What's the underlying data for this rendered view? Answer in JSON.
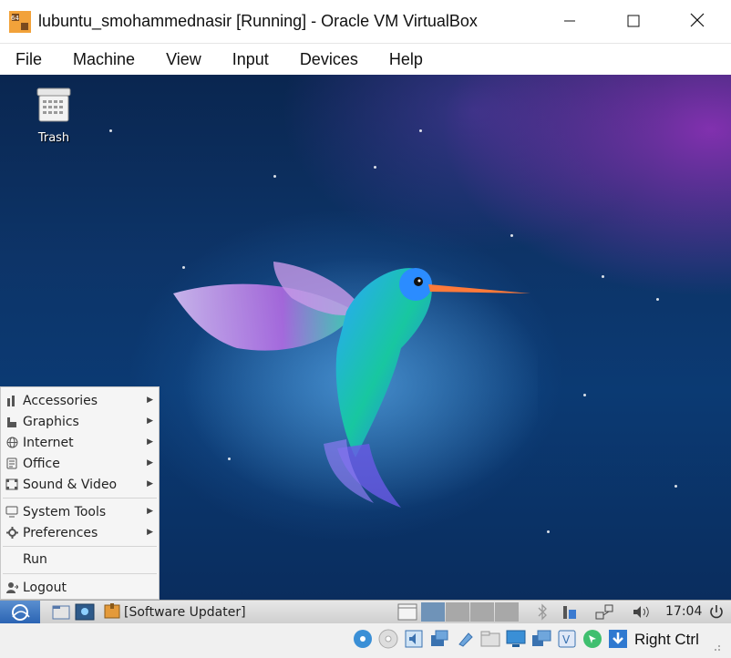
{
  "window": {
    "title": "lubuntu_smohammednasir [Running] - Oracle VM VirtualBox",
    "controls": [
      "minimize-icon",
      "maximize-icon",
      "close-icon"
    ]
  },
  "menubar": {
    "items": [
      "File",
      "Machine",
      "View",
      "Input",
      "Devices",
      "Help"
    ]
  },
  "desktop": {
    "icons": [
      {
        "label": "Trash",
        "icon": "trash-icon"
      }
    ]
  },
  "start_menu": {
    "items": [
      {
        "label": "Accessories",
        "icon": "accessories-icon",
        "submenu": true
      },
      {
        "label": "Graphics",
        "icon": "graphics-icon",
        "submenu": true
      },
      {
        "label": "Internet",
        "icon": "globe-icon",
        "submenu": true
      },
      {
        "label": "Office",
        "icon": "office-icon",
        "submenu": true
      },
      {
        "label": "Sound & Video",
        "icon": "film-icon",
        "submenu": true
      },
      {
        "label": "System Tools",
        "icon": "monitor-icon",
        "submenu": true
      },
      {
        "label": "Preferences",
        "icon": "gear-icon",
        "submenu": true
      },
      {
        "label": "Run"
      },
      {
        "label": "Logout",
        "icon": "logout-icon"
      }
    ]
  },
  "taskbar": {
    "task_label": "[Software Updater]",
    "clock": "17:04",
    "workspaces": 4
  },
  "statusbar": {
    "host_key": "Right Ctrl"
  },
  "colors": {
    "start_button": "#2b64b3",
    "active_workspace": "#6f93b8"
  }
}
